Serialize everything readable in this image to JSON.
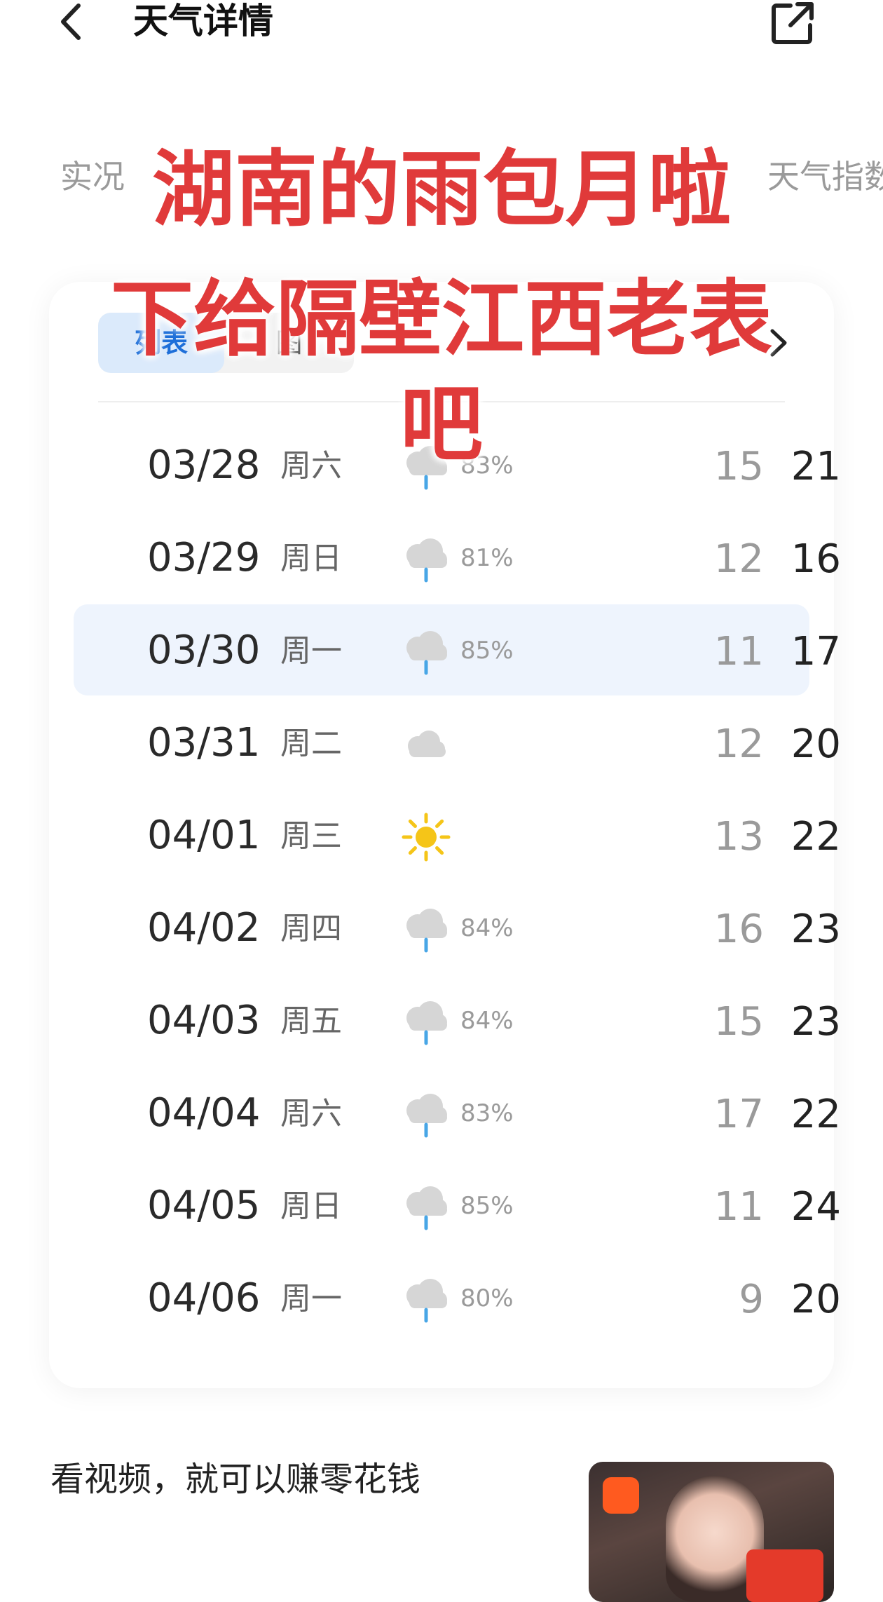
{
  "header": {
    "title": "天气详情",
    "back_icon": "chevron-left-icon",
    "share_icon": "external-share-icon"
  },
  "tabs": [
    "实况",
    "天气指数"
  ],
  "forecast": {
    "segment": {
      "active": "列表",
      "inactive": "图"
    },
    "days": [
      {
        "date": "03/28",
        "dow": "周六",
        "icon": "rain",
        "pct": "83%",
        "low": "15",
        "high": "21"
      },
      {
        "date": "03/29",
        "dow": "周日",
        "icon": "rain",
        "pct": "81%",
        "low": "12",
        "high": "16"
      },
      {
        "date": "03/30",
        "dow": "周一",
        "icon": "rain",
        "pct": "85%",
        "low": "11",
        "high": "17",
        "highlight": true
      },
      {
        "date": "03/31",
        "dow": "周二",
        "icon": "cloudy",
        "pct": "",
        "low": "12",
        "high": "20"
      },
      {
        "date": "04/01",
        "dow": "周三",
        "icon": "sunny",
        "pct": "",
        "low": "13",
        "high": "22"
      },
      {
        "date": "04/02",
        "dow": "周四",
        "icon": "rain",
        "pct": "84%",
        "low": "16",
        "high": "23"
      },
      {
        "date": "04/03",
        "dow": "周五",
        "icon": "rain",
        "pct": "84%",
        "low": "15",
        "high": "23"
      },
      {
        "date": "04/04",
        "dow": "周六",
        "icon": "rain",
        "pct": "83%",
        "low": "17",
        "high": "22"
      },
      {
        "date": "04/05",
        "dow": "周日",
        "icon": "rain",
        "pct": "85%",
        "low": "11",
        "high": "24"
      },
      {
        "date": "04/06",
        "dow": "周一",
        "icon": "rain",
        "pct": "80%",
        "low": "9",
        "high": "20"
      }
    ]
  },
  "overlay": {
    "line1": "湖南的雨包月啦",
    "line2": "下给隔壁江西老表",
    "line3": "吧",
    "color": "#e03a3a"
  },
  "promo": {
    "text": "看视频，就可以赚零花钱"
  }
}
